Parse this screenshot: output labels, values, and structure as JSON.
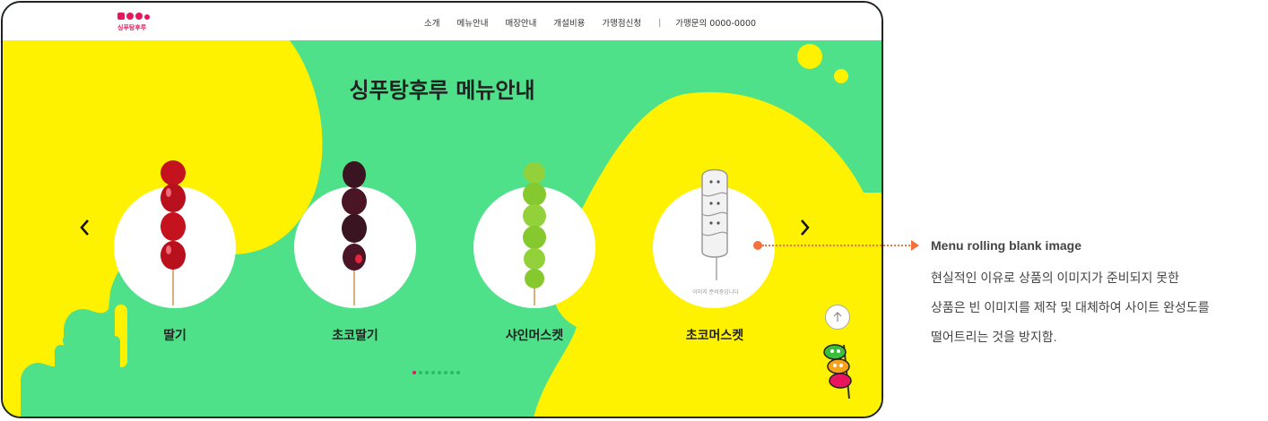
{
  "header": {
    "logo_top": "♥ ●●",
    "logo_name": "싱푸탕후루",
    "nav": [
      "소개",
      "메뉴안내",
      "매장안내",
      "개설비용",
      "가맹점신청"
    ],
    "separator": "|",
    "phone": "가맹문의 0000-0000"
  },
  "main": {
    "title": "싱푸탕후루 메뉴안내",
    "products": [
      {
        "name": "딸기"
      },
      {
        "name": "초코딸기"
      },
      {
        "name": "샤인머스켓"
      },
      {
        "name": "초코머스켓",
        "placeholder_text": "이미지 준비중입니다"
      }
    ],
    "pagination": {
      "count": 8,
      "active": 0
    },
    "top_button_icon": "arrow-up-icon"
  },
  "annotation": {
    "heading": "Menu rolling blank image",
    "lines": [
      "현실적인 이유로 상품의 이미지가 준비되지 못한",
      "상품은 빈 이미지를 제작 및 대체하여 사이트 완성도를",
      "떨어트리는 것을 방지함."
    ]
  },
  "colors": {
    "green": "#4fe18a",
    "yellow": "#fff200",
    "accent": "#f4703a",
    "active_dot": "#e8175d"
  }
}
